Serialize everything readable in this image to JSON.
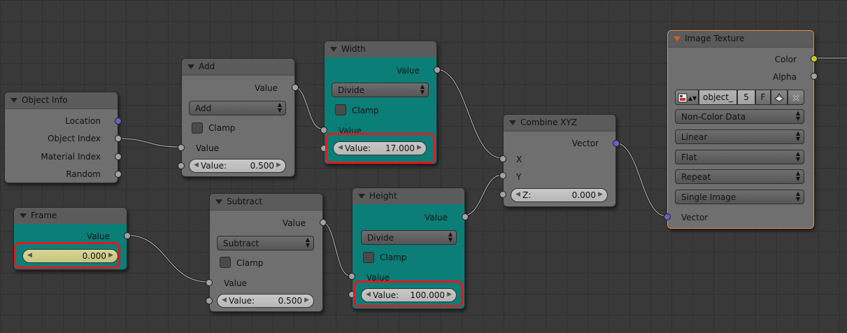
{
  "nodes": {
    "object_info": {
      "title": "Object Info",
      "outputs": [
        "Location",
        "Object Index",
        "Material Index",
        "Random"
      ]
    },
    "frame": {
      "title": "Frame",
      "output": "Value",
      "value": "0.000"
    },
    "add": {
      "title": "Add",
      "output": "Value",
      "operation": "Add",
      "clamp": "Clamp",
      "input_label": "Value",
      "field_label": "Value:",
      "field_value": "0.500"
    },
    "subtract": {
      "title": "Subtract",
      "output": "Value",
      "operation": "Subtract",
      "clamp": "Clamp",
      "input_label": "Value",
      "field_label": "Value:",
      "field_value": "0.500"
    },
    "width": {
      "title": "Width",
      "output": "Value",
      "operation": "Divide",
      "clamp": "Clamp",
      "input_label": "Value",
      "field_label": "Value:",
      "field_value": "17.000"
    },
    "height": {
      "title": "Height",
      "output": "Value",
      "operation": "Divide",
      "clamp": "Clamp",
      "input_label": "Value",
      "field_label": "Value:",
      "field_value": "100.000"
    },
    "combine_xyz": {
      "title": "Combine XYZ",
      "output": "Vector",
      "input_x": "X",
      "input_y": "Y",
      "field_label": "Z:",
      "field_value": "0.000"
    },
    "image_texture": {
      "title": "Image Texture",
      "output_color": "Color",
      "output_alpha": "Alpha",
      "image_name": "object_",
      "users": "5",
      "fake_user": "F",
      "color_space": "Non-Color Data",
      "interpolation": "Linear",
      "projection": "Flat",
      "extension": "Repeat",
      "source": "Single Image",
      "input": "Vector"
    }
  },
  "colors": {
    "background": "#393939",
    "node": "#6f6f6f",
    "teal_node": "#0b7e78",
    "highlight": "#e8161e",
    "vector_socket": "#6363c7",
    "color_socket": "#c7c729",
    "float_socket": "#a1a1a1",
    "selected_outline": "#e08a40"
  },
  "icons": [
    "collapse-arrow-icon",
    "image-icon",
    "pack-icon",
    "close-icon",
    "dropdown-arrows-icon"
  ]
}
